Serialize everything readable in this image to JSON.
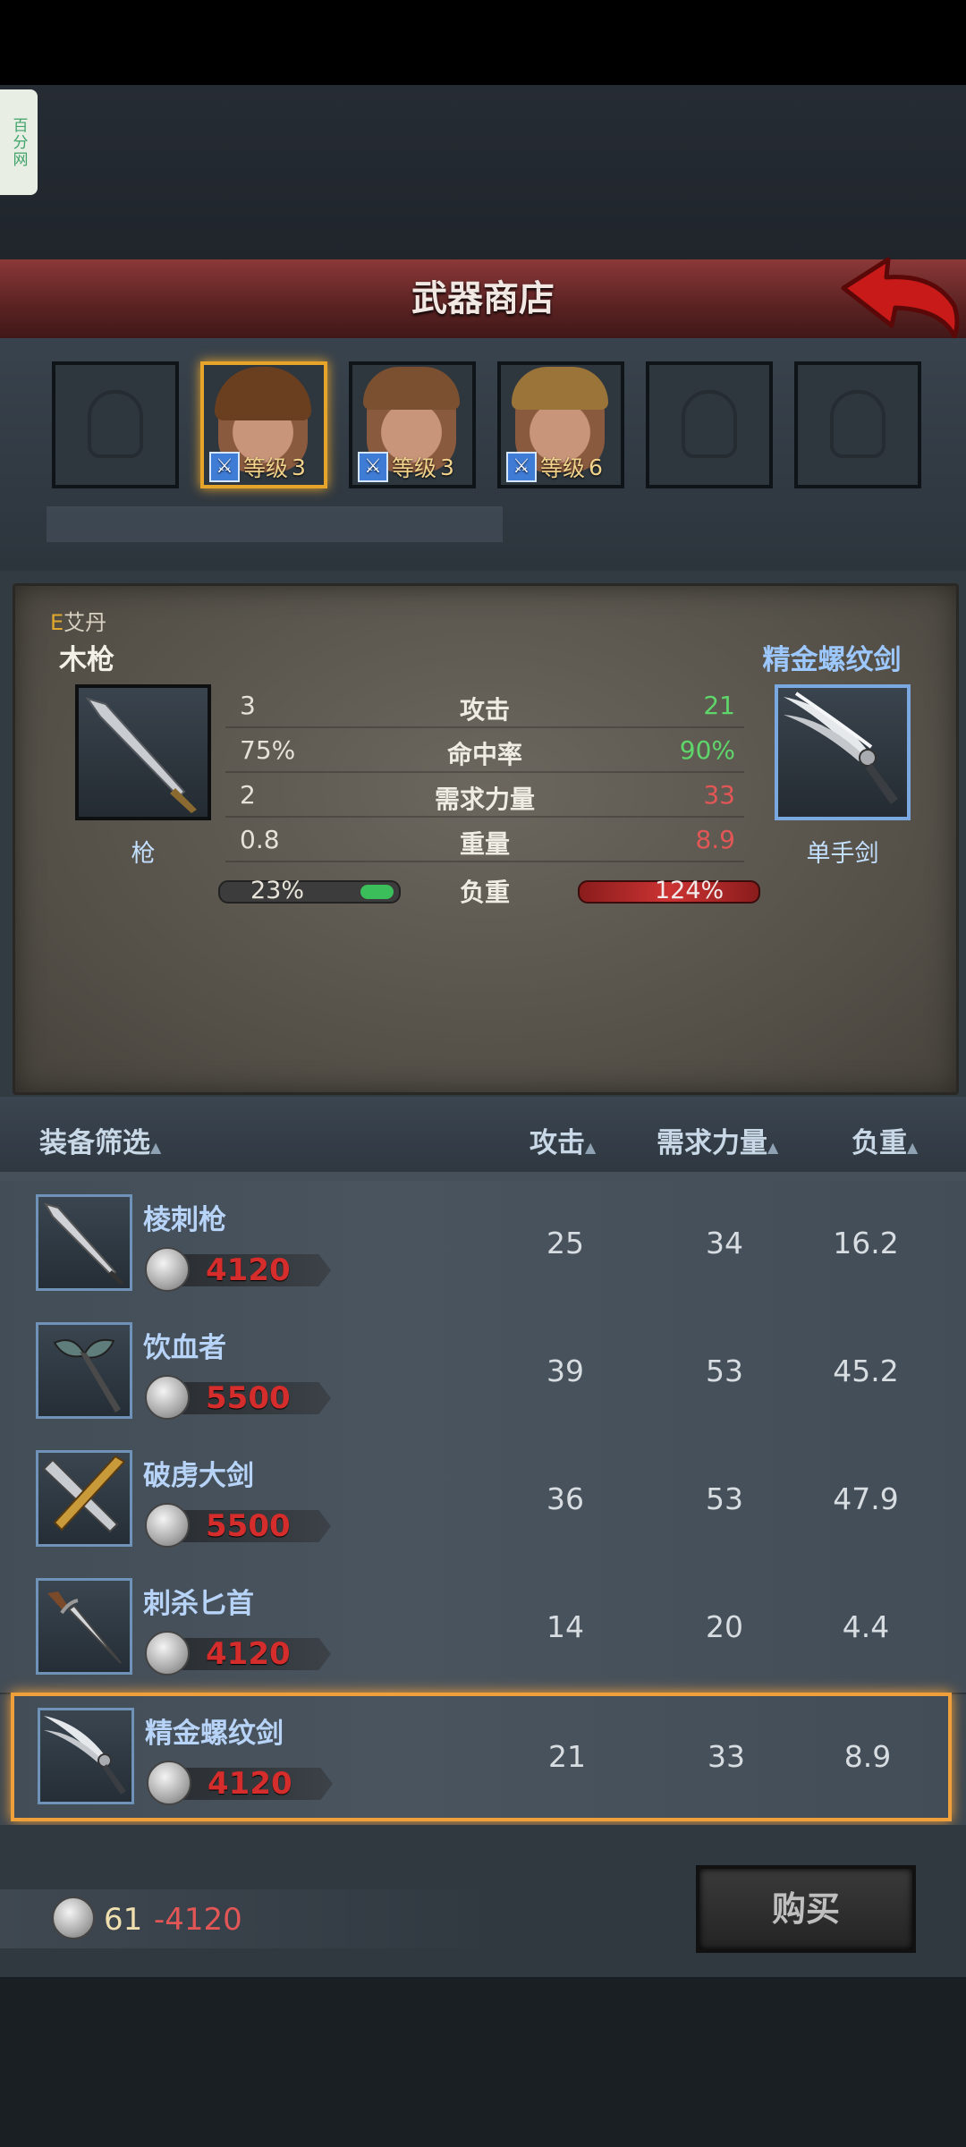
{
  "badge_text": "百分网",
  "header": {
    "title": "武器商店"
  },
  "characters": [
    {
      "portrait": "helmet-placeholder",
      "level": ""
    },
    {
      "portrait": "portrait-brown-long-hair",
      "level_label": "等级",
      "level": "3",
      "selected": true
    },
    {
      "portrait": "portrait-brown-short-hair",
      "level_label": "等级",
      "level": "3"
    },
    {
      "portrait": "portrait-blond",
      "level_label": "等级",
      "level": "6"
    },
    {
      "portrait": "helmet-placeholder",
      "level": ""
    },
    {
      "portrait": "helmet-placeholder",
      "level": ""
    }
  ],
  "compare": {
    "owner_grade": "E",
    "owner_name": "艾丹",
    "current": {
      "name": "木枪",
      "type": "枪",
      "icon": "spear-icon"
    },
    "candidate": {
      "name": "精金螺纹剑",
      "type": "单手剑",
      "icon": "sword-icon"
    },
    "stats": [
      {
        "label": "攻击",
        "current": "3",
        "new": "21",
        "tone": "green"
      },
      {
        "label": "命中率",
        "current": "75%",
        "new": "90%",
        "tone": "green"
      },
      {
        "label": "需求力量",
        "current": "2",
        "new": "33",
        "tone": "red"
      },
      {
        "label": "重量",
        "current": "0.8",
        "new": "8.9",
        "tone": "red"
      }
    ],
    "load": {
      "label": "负重",
      "current": "23%",
      "new": "124%",
      "current_fraction": 0.23,
      "new_fraction": 1.24
    }
  },
  "list_header": {
    "filter": "装备筛选",
    "attack": "攻击",
    "strength": "需求力量",
    "weight": "负重"
  },
  "items": [
    {
      "name": "棱刺枪",
      "price": "4120",
      "attack": "25",
      "strength": "34",
      "weight": "16.2",
      "icon": "spear-icon"
    },
    {
      "name": "饮血者",
      "price": "5500",
      "attack": "39",
      "strength": "53",
      "weight": "45.2",
      "icon": "axe-icon"
    },
    {
      "name": "破虏大剑",
      "price": "5500",
      "attack": "36",
      "strength": "53",
      "weight": "47.9",
      "icon": "greatsword-icon"
    },
    {
      "name": "刺杀匕首",
      "price": "4120",
      "attack": "14",
      "strength": "20",
      "weight": "4.4",
      "icon": "dagger-icon"
    },
    {
      "name": "精金螺纹剑",
      "price": "4120",
      "attack": "21",
      "strength": "33",
      "weight": "8.9",
      "icon": "sword-icon",
      "selected": true
    }
  ],
  "footer": {
    "gold": "61",
    "cost": "-4120",
    "buy_label": "购买"
  },
  "colors": {
    "accent": "#f0a03a",
    "title_bar": "#6b2a2a",
    "price": "#d52c2c",
    "better": "#5fd66a",
    "worse": "#e25656"
  }
}
